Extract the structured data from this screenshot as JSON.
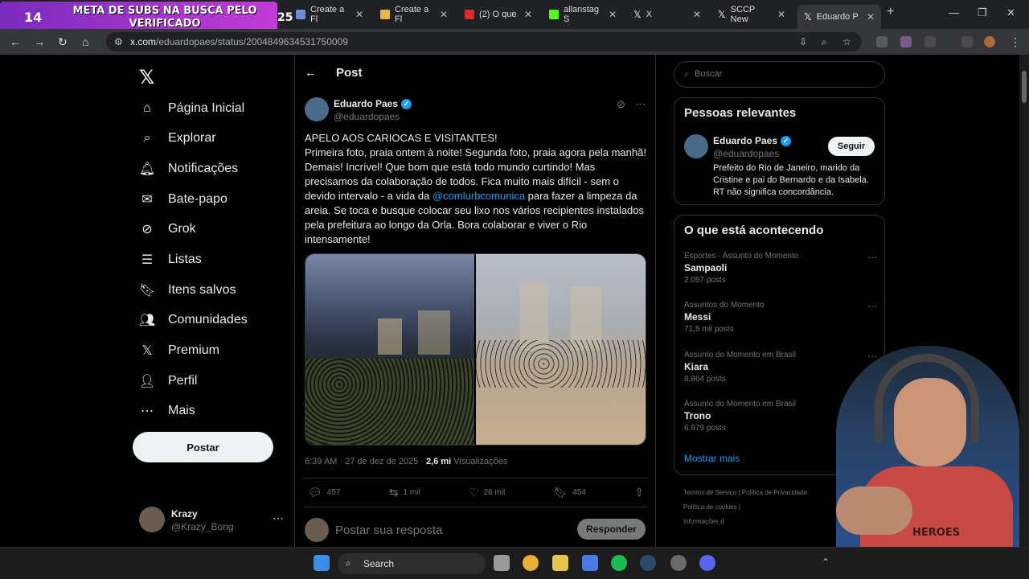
{
  "stream_overlay": {
    "count_left": "14",
    "goal_text": "META DE SUBS NA BUSCA PELO VERIFICADO",
    "count_right": "25"
  },
  "browser": {
    "tabs": [
      {
        "label": "Create a Fl"
      },
      {
        "label": "Create a Fl"
      },
      {
        "label": "(2) O que"
      },
      {
        "label": "allanstag S"
      },
      {
        "label": "X"
      },
      {
        "label": "SCCP New"
      },
      {
        "label": "Eduardo P"
      }
    ],
    "url_domain": "x.com",
    "url_path": "/eduardopaes/status/2004849634531750009"
  },
  "sidebar": {
    "items": [
      {
        "label": "Página Inicial",
        "icon": "home-icon"
      },
      {
        "label": "Explorar",
        "icon": "search-icon"
      },
      {
        "label": "Notificações",
        "icon": "bell-icon"
      },
      {
        "label": "Bate-papo",
        "icon": "mail-icon"
      },
      {
        "label": "Grok",
        "icon": "grok-icon"
      },
      {
        "label": "Listas",
        "icon": "list-icon"
      },
      {
        "label": "Itens salvos",
        "icon": "bookmark-icon"
      },
      {
        "label": "Comunidades",
        "icon": "communities-icon"
      },
      {
        "label": "Premium",
        "icon": "x-icon"
      },
      {
        "label": "Perfil",
        "icon": "profile-icon"
      },
      {
        "label": "Mais",
        "icon": "more-icon"
      }
    ],
    "post_button": "Postar",
    "user": {
      "name": "Krazy",
      "handle": "@Krazy_Bong"
    }
  },
  "post": {
    "header_title": "Post",
    "author_name": "Eduardo Paes",
    "author_handle": "@eduardopaes",
    "text_before_mention": "APELO AOS CARIOCAS E VISITANTES!\nPrimeira foto, praia ontem à noite!  Segunda foto, praia agora pela manhã!  Demais!  Incrível!  Que bom que está todo mundo curtindo!  Mas precisamos da colaboração de todos.  Fica muito mais difícil - sem o devido intervalo - a vida da ",
    "mention": "@comlurbcomunica",
    "text_after_mention": " para fazer a limpeza da areia.  Se toca e busque colocar seu lixo nos vários recipientes instalados pela prefeitura ao longo da Orla.  Bora colaborar e viver o Rio intensamente!",
    "timestamp": "6:39 AM · 27 de dez de 2025 · ",
    "views_count": "2,6 mi",
    "views_label": " Visualizações",
    "replies": "457",
    "reposts": "1 mil",
    "likes": "26 mil",
    "bookmarks": "454",
    "reply_placeholder": "Postar sua resposta",
    "reply_button": "Responder"
  },
  "right": {
    "search_placeholder": "Buscar",
    "relevant_title": "Pessoas relevantes",
    "relevant_name": "Eduardo Paes",
    "relevant_handle": "@eduardopaes",
    "follow_button": "Seguir",
    "relevant_bio": "Prefeito do Rio de Janeiro, marido da Cristine e pai do Bernardo e da Isabela. RT não significa concordância.",
    "trends_title": "O que está acontecendo",
    "trends": [
      {
        "category": "Esportes · Assunto do Momento",
        "name": "Sampaoli",
        "count": "2.057 posts"
      },
      {
        "category": "Assuntos do Momento",
        "name": "Messi",
        "count": "71,5 mil posts"
      },
      {
        "category": "Assunto do Momento em Brasil",
        "name": "Kiara",
        "count": "8.864 posts"
      },
      {
        "category": "Assunto do Momento em Brasil",
        "name": "Trono",
        "count": "6.979 posts"
      }
    ],
    "show_more": "Mostrar mais",
    "footer_line1": "Termos de Serviço  |  Política de Privacidade",
    "footer_line2": "Política de cookies  |",
    "footer_line3": "Informações d"
  },
  "webcam": {
    "shirt_text": "HEROES"
  },
  "taskbar": {
    "search_label": "Search"
  }
}
